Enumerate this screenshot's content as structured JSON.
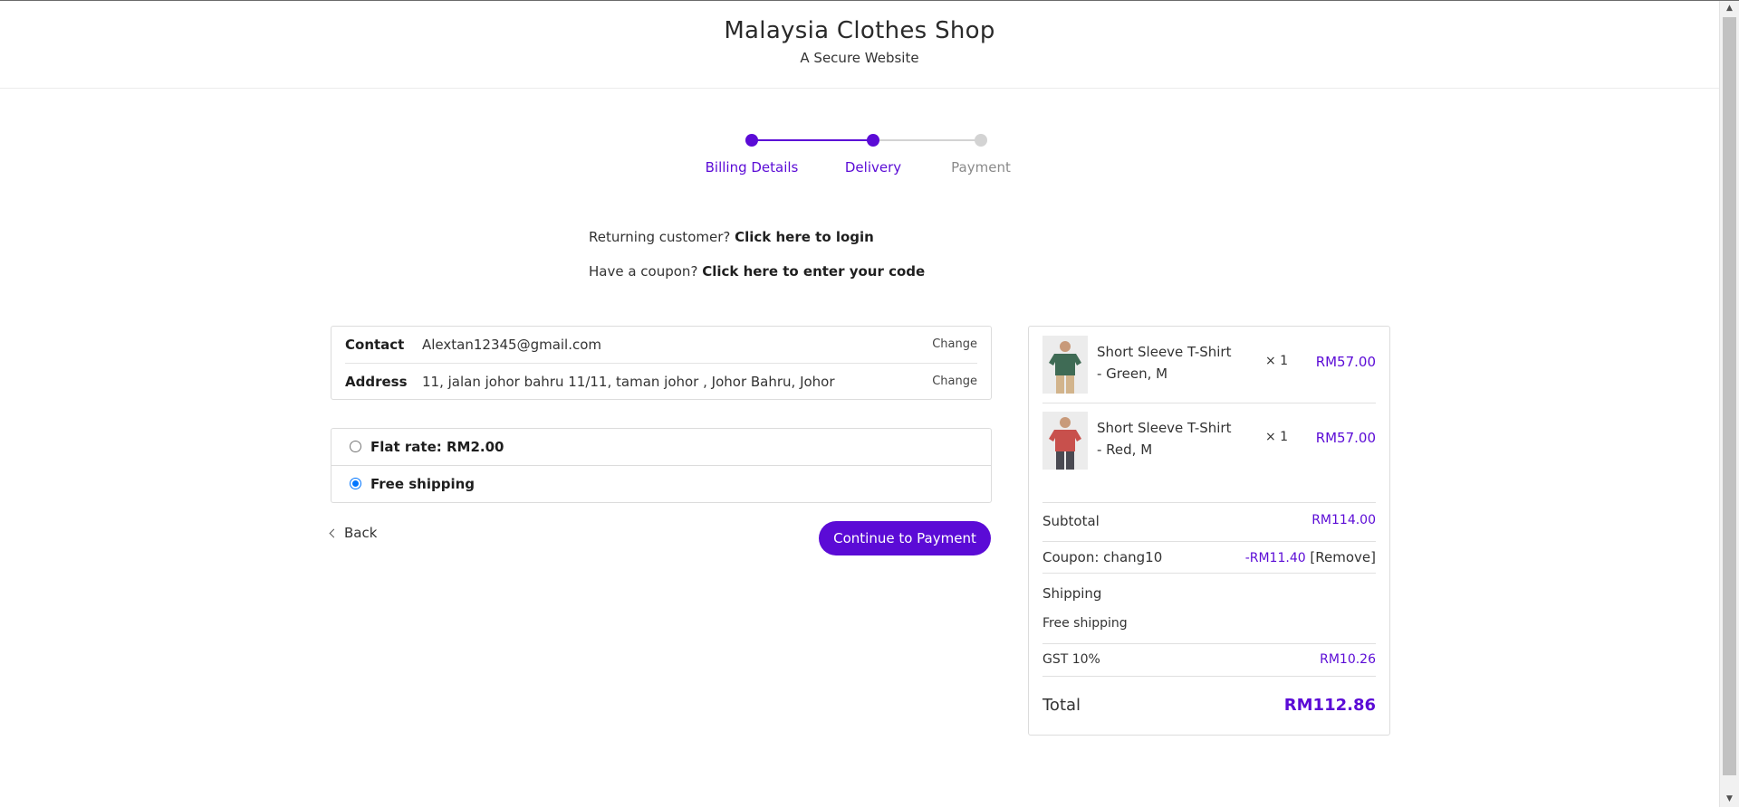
{
  "header": {
    "title": "Malaysia Clothes Shop",
    "subtitle": "A Secure Website"
  },
  "steps": [
    {
      "label": "Billing Details",
      "state": "complete"
    },
    {
      "label": "Delivery",
      "state": "current"
    },
    {
      "label": "Payment",
      "state": "upcoming"
    }
  ],
  "notices": {
    "login_text": "Returning customer?",
    "login_link": "Click here to login",
    "coupon_text": "Have a coupon?",
    "coupon_link": "Click here to enter your code"
  },
  "info": {
    "contact_label": "Contact",
    "contact_value": "Alextan12345@gmail.com",
    "address_label": "Address",
    "address_value": "11, jalan johor bahru 11/11, taman johor , Johor Bahru, Johor",
    "change_label": "Change"
  },
  "shipping_options": [
    {
      "label": "Flat rate: RM2.00",
      "selected": false
    },
    {
      "label": "Free shipping",
      "selected": true
    }
  ],
  "actions": {
    "back_label": "Back",
    "continue_label": "Continue to Payment"
  },
  "order": {
    "items": [
      {
        "name": "Short Sleeve T-Shirt - Green, M",
        "qty": "× 1",
        "price": "RM57.00",
        "shirt_color": "#3f6b55"
      },
      {
        "name": "Short Sleeve T-Shirt - Red, M",
        "qty": "× 1",
        "price": "RM57.00",
        "shirt_color": "#c8504c"
      }
    ],
    "subtotal_label": "Subtotal",
    "subtotal_value": "RM114.00",
    "coupon_label": "Coupon: chang10",
    "coupon_value": "-RM11.40",
    "coupon_remove": "[Remove]",
    "shipping_label": "Shipping",
    "shipping_value": "Free shipping",
    "gst_label": "GST 10%",
    "gst_value": "RM10.26",
    "total_label": "Total",
    "total_value": "RM112.86"
  },
  "colors": {
    "accent": "#5b0bd6",
    "inactive": "#d3d3d3",
    "radio": "#0075ff"
  }
}
